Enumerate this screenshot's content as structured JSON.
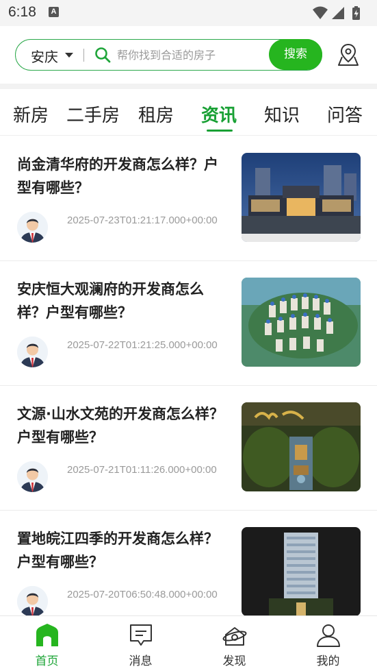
{
  "status_bar": {
    "time": "6:18",
    "notification_badge": "A"
  },
  "search": {
    "city": "安庆",
    "placeholder": "帮你找到合适的房子",
    "button_label": "搜索",
    "accent_color": "#26b51f"
  },
  "tabs": [
    {
      "label": "新房",
      "active": false
    },
    {
      "label": "二手房",
      "active": false
    },
    {
      "label": "租房",
      "active": false
    },
    {
      "label": "资讯",
      "active": true
    },
    {
      "label": "知识",
      "active": false
    },
    {
      "label": "问答",
      "active": false
    }
  ],
  "articles": [
    {
      "title": "尚金清华府的开发商怎么样？户型有哪些？",
      "date": "2025-07-23T01:21:17.000+00:00",
      "thumbnail": "night-gate-building"
    },
    {
      "title": "安庆恒大观澜府的开发商怎么样？户型有哪些？",
      "date": "2025-07-22T01:21:25.000+00:00",
      "thumbnail": "aerial-residential-complex"
    },
    {
      "title": "文源·山水文苑的开发商怎么样？户型有哪些？",
      "date": "2025-07-21T01:11:26.000+00:00",
      "thumbnail": "garden-aerial-view"
    },
    {
      "title": "置地皖江四季的开发商怎么样？户型有哪些？",
      "date": "2025-07-20T06:50:48.000+00:00",
      "thumbnail": "residential-tower"
    }
  ],
  "bottom_nav": [
    {
      "label": "首页",
      "icon": "home-icon",
      "active": true
    },
    {
      "label": "消息",
      "icon": "message-icon",
      "active": false
    },
    {
      "label": "发现",
      "icon": "discover-icon",
      "active": false
    },
    {
      "label": "我的",
      "icon": "profile-icon",
      "active": false
    }
  ]
}
